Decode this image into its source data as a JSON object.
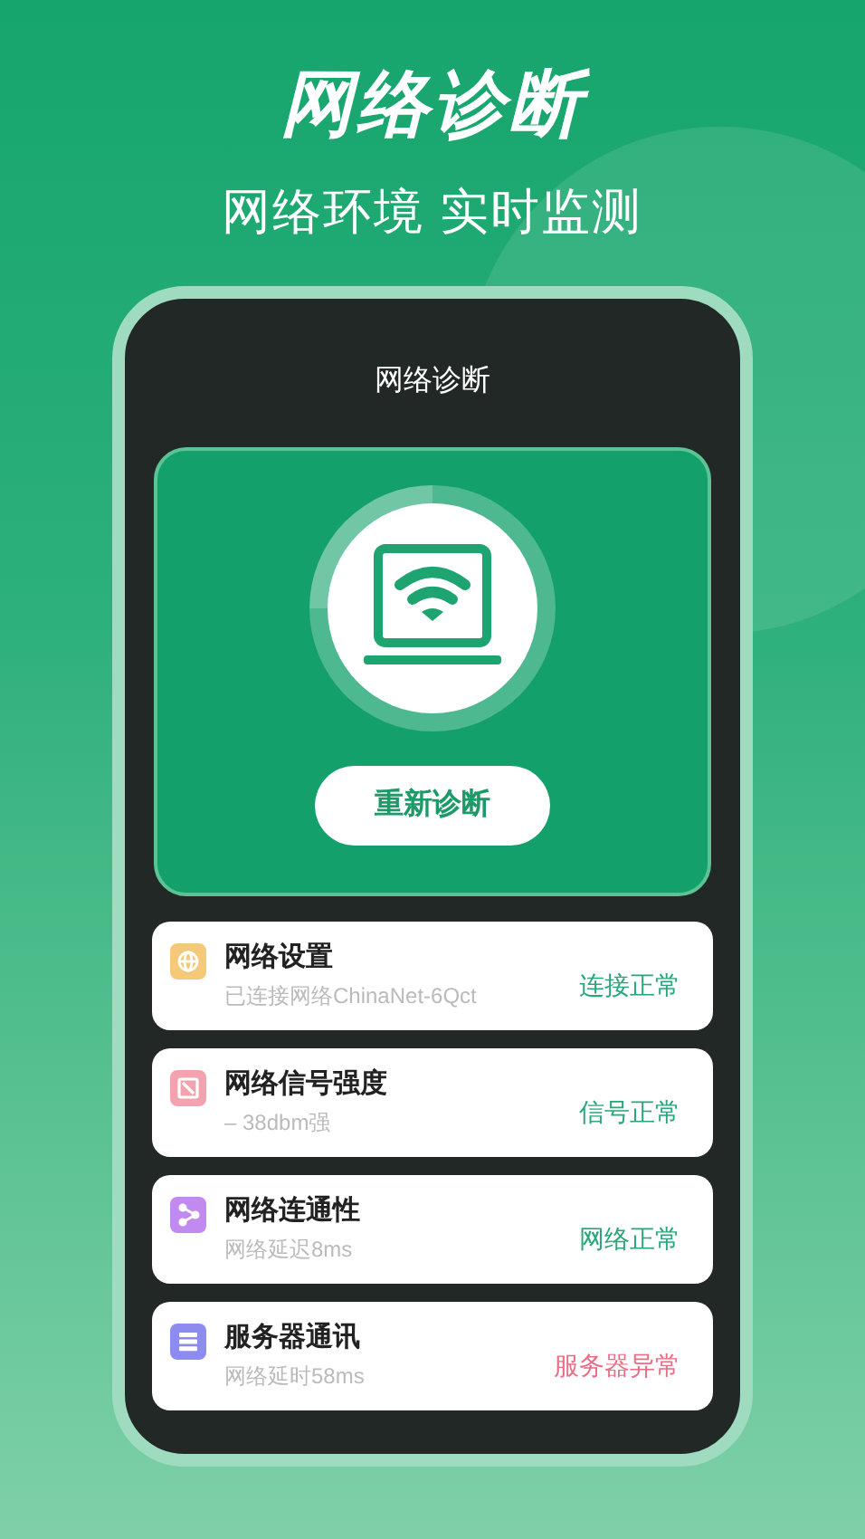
{
  "headline": "网络诊断",
  "subheadline": "网络环境 实时监测",
  "screen": {
    "title": "网络诊断",
    "rediagnose_button": "重新诊断",
    "items": [
      {
        "kind": "globe",
        "color": "#f5c97a",
        "title": "网络设置",
        "detail": "已连接网络ChinaNet-6Qct",
        "status": "连接正常",
        "error": false
      },
      {
        "kind": "signal",
        "color": "#f3a3b0",
        "title": "网络信号强度",
        "detail": "– 38dbm强",
        "status": "信号正常",
        "error": false
      },
      {
        "kind": "share",
        "color": "#c08af0",
        "title": "网络连通性",
        "detail": "网络延迟8ms",
        "status": "网络正常",
        "error": false
      },
      {
        "kind": "server",
        "color": "#8c8cf0",
        "title": "服务器通讯",
        "detail": "网络延时58ms",
        "status": "服务器异常",
        "error": true
      }
    ]
  }
}
